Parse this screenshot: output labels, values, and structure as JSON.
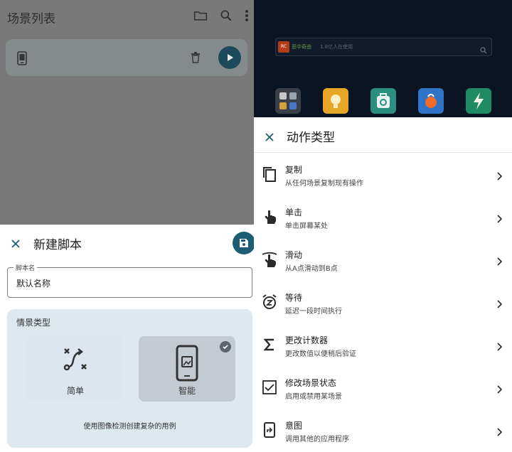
{
  "left": {
    "title": "场景列表",
    "sheet_title": "新建脚本",
    "name_field": {
      "label": "脚本名",
      "value": "默认名称"
    },
    "type_section": {
      "label": "情景类型",
      "options": [
        {
          "label": "简单",
          "selected": false
        },
        {
          "label": "智能",
          "selected": true
        }
      ],
      "description": "使用图像检测创建复杂的用例"
    }
  },
  "right": {
    "search": {
      "brand_badge": "RC",
      "brand_name": "恶中奇由",
      "placeholder": "1.8亿人在使用"
    },
    "sheet_title": "动作类型",
    "actions": [
      {
        "icon": "copy-icon",
        "title": "复制",
        "desc": "从任何场景复制现有操作"
      },
      {
        "icon": "tap-icon",
        "title": "单击",
        "desc": "单击屏幕某处"
      },
      {
        "icon": "swipe-icon",
        "title": "滑动",
        "desc": "从A点滑动到B点"
      },
      {
        "icon": "snooze-icon",
        "title": "等待",
        "desc": "延迟一段时间执行"
      },
      {
        "icon": "sigma-icon",
        "title": "更改计数器",
        "desc": "更改数值以便稍后验证"
      },
      {
        "icon": "checkbox-icon",
        "title": "修改场景状态",
        "desc": "启用或禁用某场景"
      },
      {
        "icon": "intent-icon",
        "title": "意图",
        "desc": "调用其他的应用程序"
      }
    ]
  },
  "colors": {
    "accent": "#1d5d73",
    "dim_overlay": "#797979",
    "type_box": "#dde8ef"
  }
}
